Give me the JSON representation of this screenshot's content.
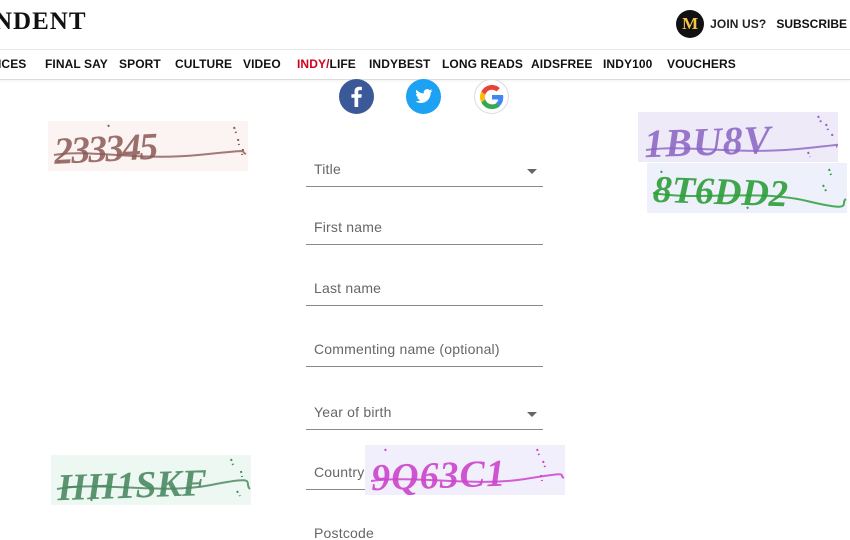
{
  "header": {
    "logo_text": "NDENT",
    "badge_letter": "M",
    "join_label": "JOIN US?",
    "subscribe_label": "SUBSCRIBE"
  },
  "nav": {
    "items": [
      {
        "label": "ICES"
      },
      {
        "label": "FINAL SAY"
      },
      {
        "label": "SPORT"
      },
      {
        "label": "CULTURE"
      },
      {
        "label": "VIDEO"
      },
      {
        "label_prefix": "INDY/",
        "label_suffix": "LIFE"
      },
      {
        "label": "INDYBEST"
      },
      {
        "label": "LONG READS"
      },
      {
        "label": "AIDSFREE"
      },
      {
        "label": "INDY100"
      },
      {
        "label": "VOUCHERS"
      }
    ],
    "accent_color": "#d0021b"
  },
  "social": {
    "facebook_icon": "facebook-icon",
    "twitter_icon": "twitter-icon",
    "google_icon": "google-icon",
    "facebook_color": "#3b5998",
    "twitter_color": "#1da1f2"
  },
  "form": {
    "title_label": "Title",
    "first_name_label": "First name",
    "last_name_label": "Last name",
    "commenting_name_label": "Commenting name (optional)",
    "year_of_birth_label": "Year of birth",
    "country_label": "Country",
    "postcode_label": "Postcode"
  },
  "captchas": [
    {
      "text": "233345",
      "color": "#8b5a55"
    },
    {
      "text": "1BU8V",
      "color": "#8a63c4"
    },
    {
      "text": "8T6DD2",
      "color": "#2e9e3a"
    },
    {
      "text": "HH1SKF",
      "color": "#4c8a63"
    },
    {
      "text": "9Q63C1",
      "color": "#cc44cc"
    }
  ]
}
